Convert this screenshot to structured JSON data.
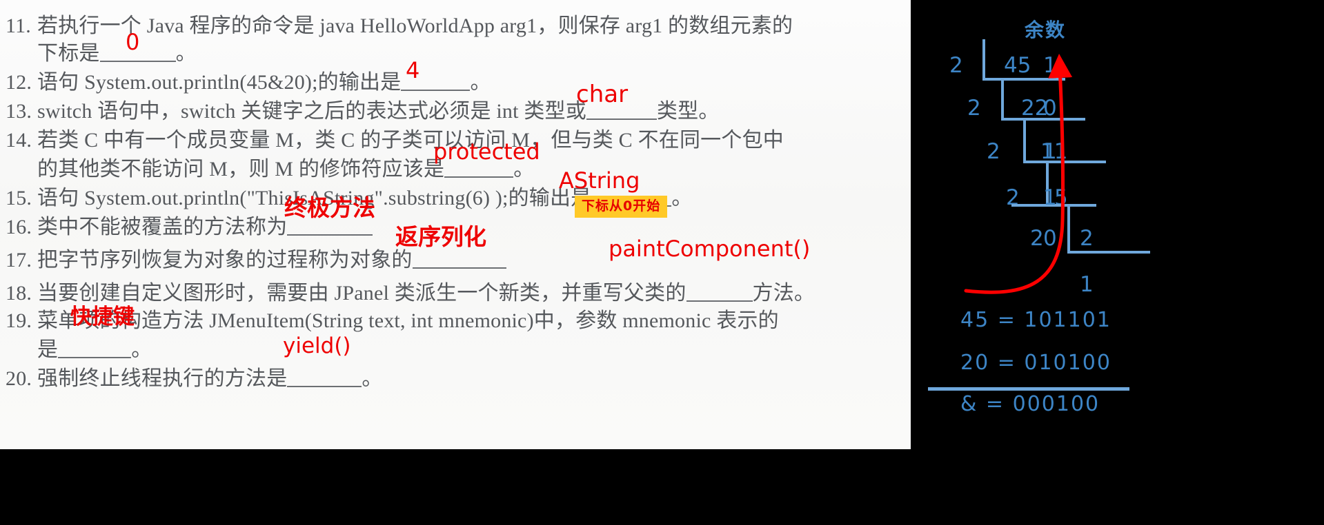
{
  "document": {
    "questions": [
      {
        "num": "11.",
        "line1": "若执行一个 Java 程序的命令是 java HelloWorldApp arg1，则保存 arg1 的数组元素的",
        "line2_pre": "下标是",
        "line2_post": "。"
      },
      {
        "num": "12.",
        "line1_pre": "语句 System.out.println(45&20);的输出是",
        "line1_post": "。"
      },
      {
        "num": "13.",
        "line1_pre": "switch 语句中，switch 关键字之后的表达式必须是 int 类型或",
        "line1_post": "类型。"
      },
      {
        "num": "14.",
        "line1": "若类 C 中有一个成员变量 M，类 C 的子类可以访问 M，但与类 C 不在同一个包中",
        "line2_pre": "的其他类不能访问 M，则 M 的修饰符应该是",
        "line2_post": "。"
      },
      {
        "num": "15.",
        "line1_pre": "语句 System.out.println(\"ThisIsAString\".substring(6) );的输出是",
        "line1_post": "。"
      },
      {
        "num": "16.",
        "line1_pre": "类中不能被覆盖的方法称为",
        "line1_post": ""
      },
      {
        "num": "17.",
        "line1_pre": "把字节序列恢复为对象的过程称为对象的",
        "line1_post": ""
      },
      {
        "num": "18.",
        "line1_pre": "当要创建自定义图形时，需要由 JPanel 类派生一个新类，并重写父类的",
        "line1_post": "方法。"
      },
      {
        "num": "19.",
        "line1": "菜单项的构造方法 JMenuItem(String text, int mnemonic)中，参数 mnemonic 表示的",
        "line2_pre": "是",
        "line2_post": "。"
      },
      {
        "num": "20.",
        "line1_pre": "强制终止线程执行的方法是",
        "line1_post": "。"
      }
    ],
    "annotations": {
      "q11_answer": "0",
      "q12_answer": "4",
      "q13_answer": "char",
      "q14_answer": "protected",
      "q15_answer": "AString",
      "q16_answer": "终极方法",
      "q17_answer": "返序列化",
      "q18_answer": "paintComponent()",
      "q19_answer": "快捷键",
      "q20_answer": "yield()",
      "highlight_note": "下标从0开始"
    }
  },
  "work_panel": {
    "remainder_title": "余数",
    "division_rows": [
      {
        "divisor": "2",
        "dividend": "45",
        "remainder": "1"
      },
      {
        "divisor": "2",
        "dividend": "22",
        "remainder": "0"
      },
      {
        "divisor": "2",
        "dividend": "11",
        "remainder": "1"
      },
      {
        "divisor": "2",
        "dividend": "5",
        "remainder": "1"
      },
      {
        "divisor": "2",
        "dividend": "2",
        "remainder": "0"
      }
    ],
    "final_quotient": "1",
    "equations": [
      "45 = 101101",
      "20 = 010100",
      "&  = 000100"
    ]
  },
  "colors": {
    "annotation_red": "#ee0000",
    "highlight_yellow": "#ffc928",
    "work_blue": "#3d85c6",
    "rule_blue": "#6fa8dc",
    "arrow_red": "#ff0000",
    "panel_black": "#000000",
    "paper_white": "#fbfbfb"
  }
}
